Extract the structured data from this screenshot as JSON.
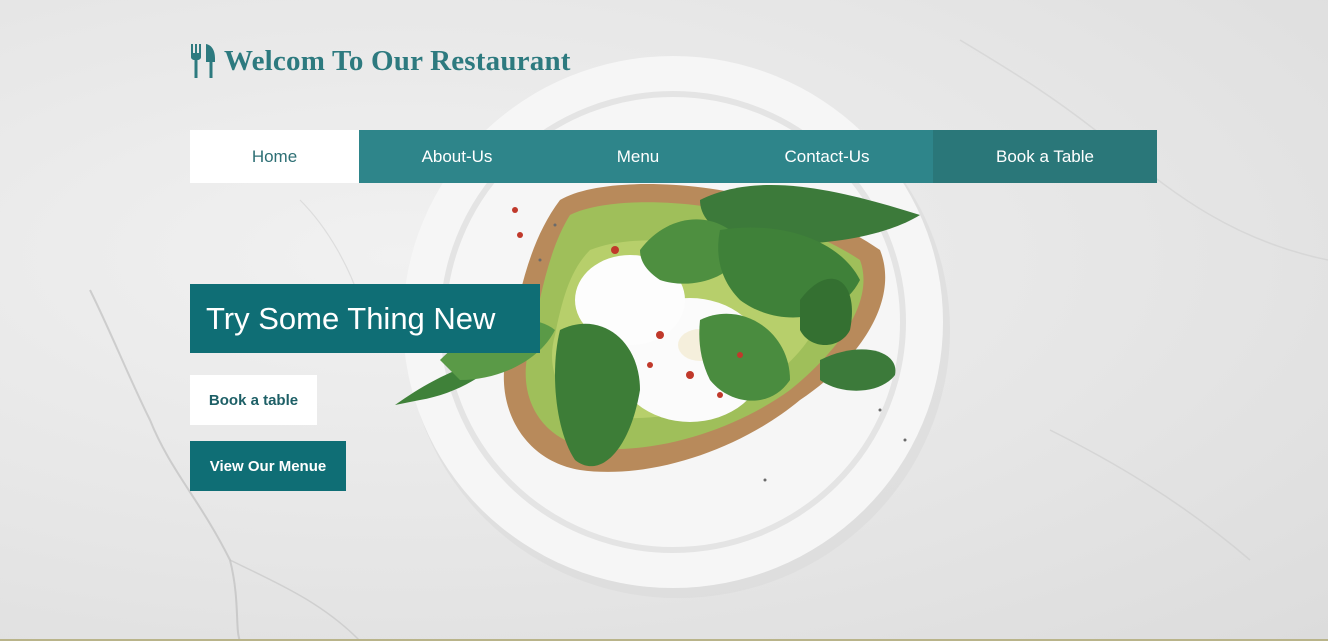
{
  "brand": {
    "icon": "fork-knife-icon",
    "title": "Welcom To Our Restaurant",
    "color": "#2d7a7f"
  },
  "nav": {
    "items": [
      {
        "label": "Home",
        "active": true
      },
      {
        "label": "About-Us"
      },
      {
        "label": "Menu"
      },
      {
        "label": "Contact-Us"
      },
      {
        "label": "Book a Table"
      }
    ],
    "color": "#2e858a",
    "active_color": "#ffffff"
  },
  "hero": {
    "headline": "Try Some Thing New",
    "book_button": "Book a table",
    "menu_button": "View Our Menue",
    "accent_color": "#0f6e75",
    "image": "avocado-toast-plate-on-marble"
  }
}
